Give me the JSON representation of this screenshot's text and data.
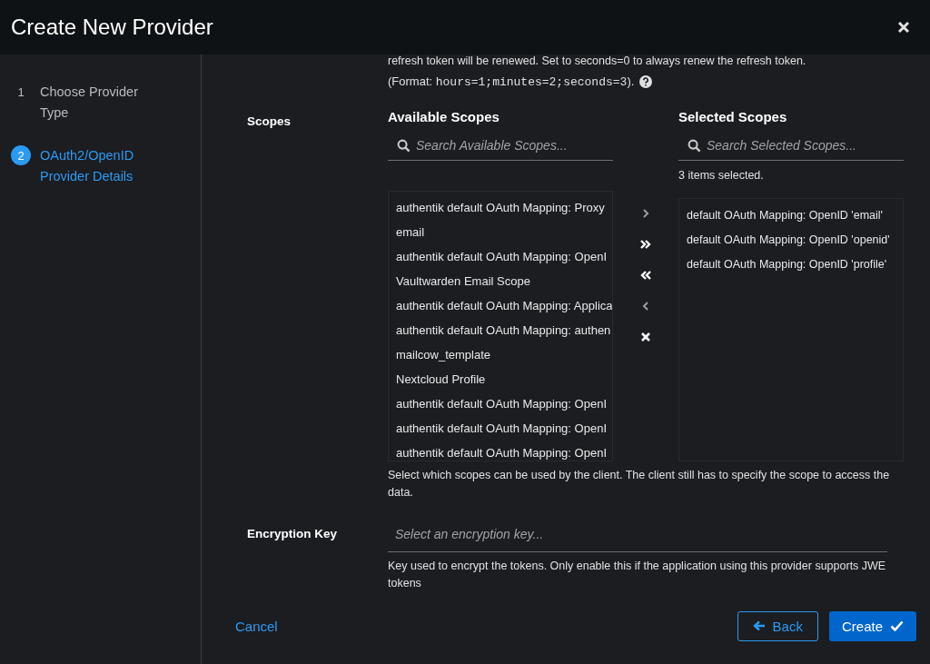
{
  "window": {
    "title": "Create New Provider"
  },
  "steps": [
    {
      "number": "1",
      "label": "Choose Provider Type",
      "selected": false
    },
    {
      "number": "2",
      "label": "OAuth2/OpenID Provider Details",
      "selected": true
    }
  ],
  "intro": {
    "cut_line": "refresh token will be renewed. Set to seconds=0 to always renew the refresh token.",
    "format_prefix": "(Format: ",
    "format_code": "hours=1;minutes=2;seconds=3",
    "format_suffix": ")."
  },
  "scopes": {
    "label": "Scopes",
    "available": {
      "title": "Available Scopes",
      "placeholder": "Search Available Scopes...",
      "items": [
        "authentik default OAuth Mapping: Proxy",
        "email",
        "authentik default OAuth Mapping: OpenI",
        "Vaultwarden Email Scope",
        "authentik default OAuth Mapping: Applica",
        "authentik default OAuth Mapping: authen",
        "mailcow_template",
        "Nextcloud Profile",
        "authentik default OAuth Mapping: OpenI",
        "authentik default OAuth Mapping: OpenI",
        "authentik default OAuth Mapping: OpenI"
      ]
    },
    "controls": [
      {
        "kind": "add",
        "disabled": true
      },
      {
        "kind": "add-all",
        "disabled": false
      },
      {
        "kind": "remove-all",
        "disabled": false
      },
      {
        "kind": "remove",
        "disabled": true
      },
      {
        "kind": "clear",
        "disabled": false
      }
    ],
    "selected": {
      "title": "Selected Scopes",
      "placeholder": "Search Selected Scopes...",
      "status": "3 items selected.",
      "items": [
        "default OAuth Mapping: OpenID 'email'",
        "default OAuth Mapping: OpenID 'openid'",
        "default OAuth Mapping: OpenID 'profile'"
      ]
    },
    "help": "Select which scopes can be used by the client. The client still has to specify the scope to access the data."
  },
  "encryption": {
    "label": "Encryption Key",
    "placeholder": "Select an encryption key...",
    "help": "Key used to encrypt the tokens. Only enable this if the application using this provider supports JWE tokens"
  },
  "footer": {
    "cancel": "Cancel",
    "back": "Back",
    "create": "Create"
  }
}
